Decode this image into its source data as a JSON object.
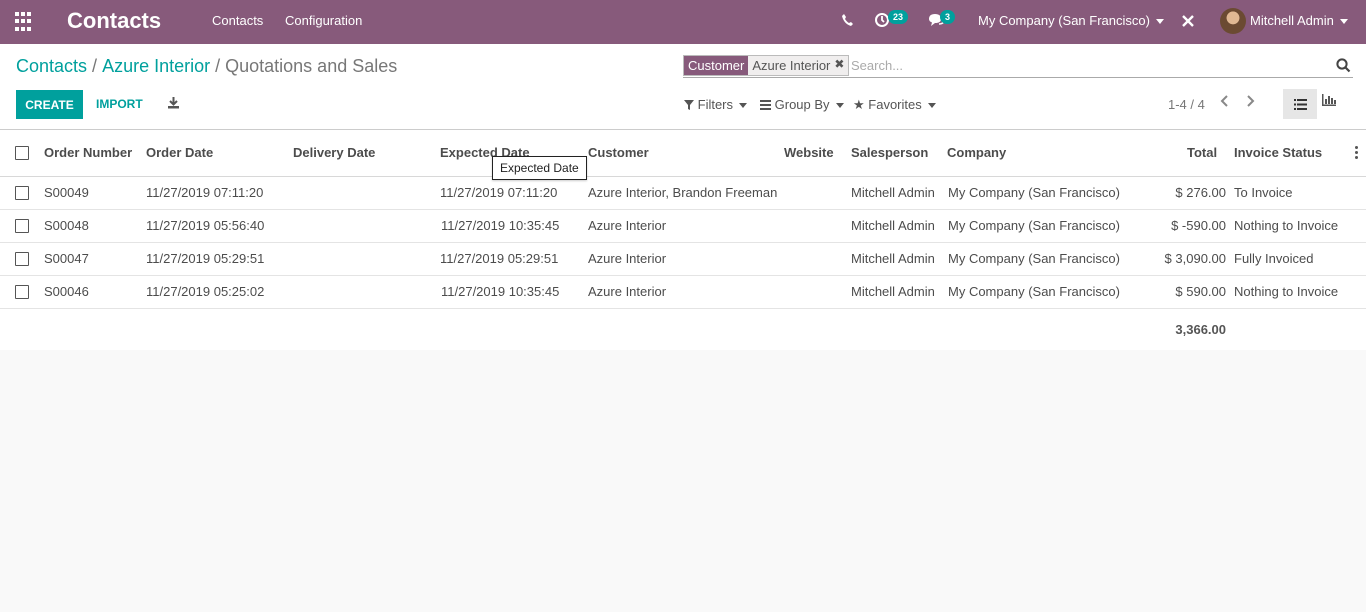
{
  "navbar": {
    "app_title": "Contacts",
    "menu": [
      "Contacts",
      "Configuration"
    ],
    "activity_count": "23",
    "messages_count": "3",
    "company": "My Company (San Francisco)",
    "user": "Mitchell Admin",
    "color": "#875a7b"
  },
  "breadcrumb": [
    "Contacts",
    "Azure Interior",
    "Quotations and Sales"
  ],
  "toolbar": {
    "create_label": "CREATE",
    "import_label": "IMPORT"
  },
  "search": {
    "facet_label": "Customer",
    "facet_value": "Azure Interior",
    "placeholder": "Search..."
  },
  "filters": {
    "filters_label": "Filters",
    "groupby_label": "Group By",
    "favorites_label": "Favorites"
  },
  "pager": {
    "text": "1-4 / 4"
  },
  "table": {
    "headers": {
      "order_number": "Order Number",
      "order_date": "Order Date",
      "delivery_date": "Delivery Date",
      "expected_date": "Expected Date",
      "customer": "Customer",
      "website": "Website",
      "salesperson": "Salesperson",
      "company": "Company",
      "total": "Total",
      "invoice_status": "Invoice Status"
    },
    "rows": [
      {
        "order_number": "S00049",
        "order_date": "11/27/2019 07:11:20",
        "expected_date": "11/27/2019 07:11:20",
        "customer": "Azure Interior, Brandon Freeman",
        "salesperson": "Mitchell Admin",
        "company": "My Company (San Francisco)",
        "total": "$ 276.00",
        "invoice_status": "To Invoice"
      },
      {
        "order_number": "S00048",
        "order_date": "11/27/2019 05:56:40",
        "expected_date": "11/27/2019 10:35:45",
        "customer": "Azure Interior",
        "salesperson": "Mitchell Admin",
        "company": "My Company (San Francisco)",
        "total": "$ -590.00",
        "invoice_status": "Nothing to Invoice"
      },
      {
        "order_number": "S00047",
        "order_date": "11/27/2019 05:29:51",
        "expected_date": "11/27/2019 05:29:51",
        "customer": "Azure Interior",
        "salesperson": "Mitchell Admin",
        "company": "My Company (San Francisco)",
        "total": "$ 3,090.00",
        "invoice_status": "Fully Invoiced"
      },
      {
        "order_number": "S00046",
        "order_date": "11/27/2019 05:25:02",
        "expected_date": "11/27/2019 10:35:45",
        "customer": "Azure Interior",
        "salesperson": "Mitchell Admin",
        "company": "My Company (San Francisco)",
        "total": "$ 590.00",
        "invoice_status": "Nothing to Invoice"
      }
    ],
    "sum_total": "3,366.00"
  },
  "tooltip": {
    "text": "Expected Date"
  }
}
